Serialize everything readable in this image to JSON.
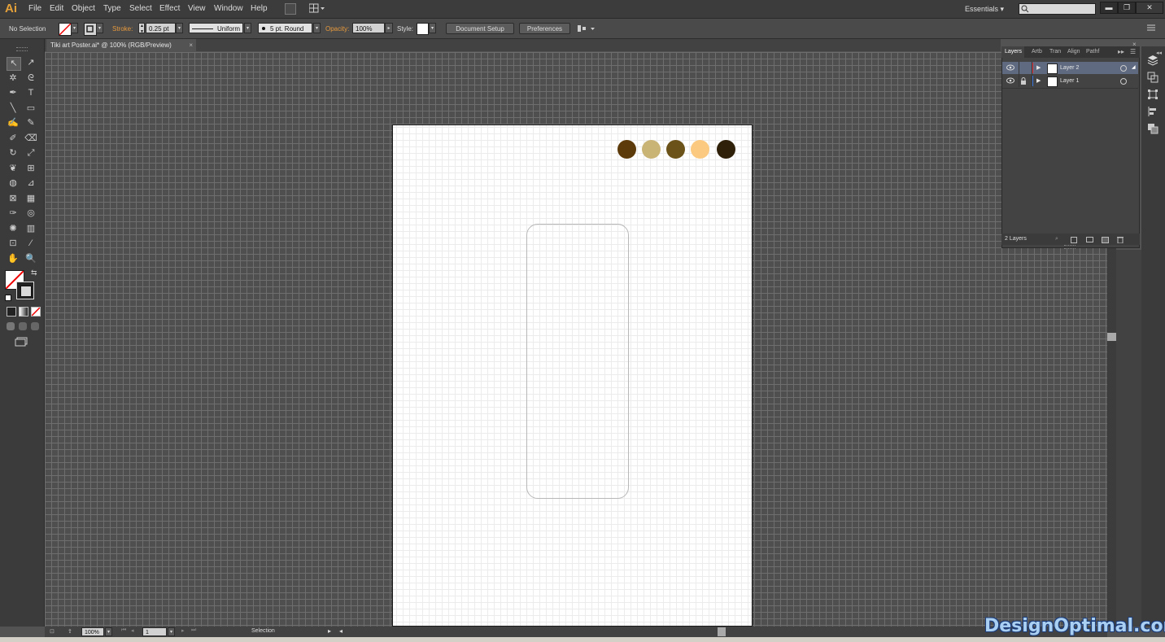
{
  "app": {
    "logo": "Ai"
  },
  "menu": {
    "items": [
      "File",
      "Edit",
      "Object",
      "Type",
      "Select",
      "Effect",
      "View",
      "Window",
      "Help"
    ]
  },
  "workspace": {
    "label": "Essentials"
  },
  "window_buttons": {
    "minimize": "▬",
    "restore": "❐",
    "close": "✕"
  },
  "control": {
    "selection": "No Selection",
    "stroke_label": "Stroke:",
    "stroke_weight": "0.25 pt",
    "profile": "Uniform",
    "brush": "5 pt. Round",
    "opacity_label": "Opacity:",
    "opacity": "100%",
    "style_label": "Style:",
    "doc_setup": "Document Setup",
    "preferences": "Preferences"
  },
  "document": {
    "tab": "Tiki art Poster.ai* @ 100% (RGB/Preview)",
    "close": "×"
  },
  "swatches": [
    "#5c3a0a",
    "#c9b476",
    "#6b5219",
    "#fbc980",
    "#2f200a"
  ],
  "layers_panel": {
    "tabs": [
      "Layers",
      "Artb",
      "Tran",
      "Align",
      "Pathf"
    ],
    "layers": [
      {
        "name": "Layer 2",
        "color": "#e8383d",
        "selected": true,
        "locked": false
      },
      {
        "name": "Layer 1",
        "color": "#3f7bde",
        "selected": false,
        "locked": true
      }
    ],
    "footer": "2 Layers"
  },
  "status": {
    "zoom": "100%",
    "artboard": "1",
    "tool": "Selection"
  },
  "watermark": "DesignOptimal.com",
  "icons": [
    "selection-tool",
    "direct-selection-tool",
    "magic-wand-tool",
    "lasso-tool",
    "pen-tool",
    "type-tool",
    "line-tool",
    "rectangle-tool",
    "paintbrush-tool",
    "pencil-tool",
    "blob-brush-tool",
    "eraser-tool",
    "rotate-tool",
    "scale-tool",
    "warp-tool",
    "free-transform-tool",
    "shape-builder-tool",
    "perspective-grid-tool",
    "mesh-tool",
    "gradient-tool",
    "eyedropper-tool",
    "blend-tool",
    "symbol-sprayer-tool",
    "column-graph-tool",
    "artboard-tool",
    "slice-tool",
    "hand-tool",
    "zoom-tool"
  ]
}
